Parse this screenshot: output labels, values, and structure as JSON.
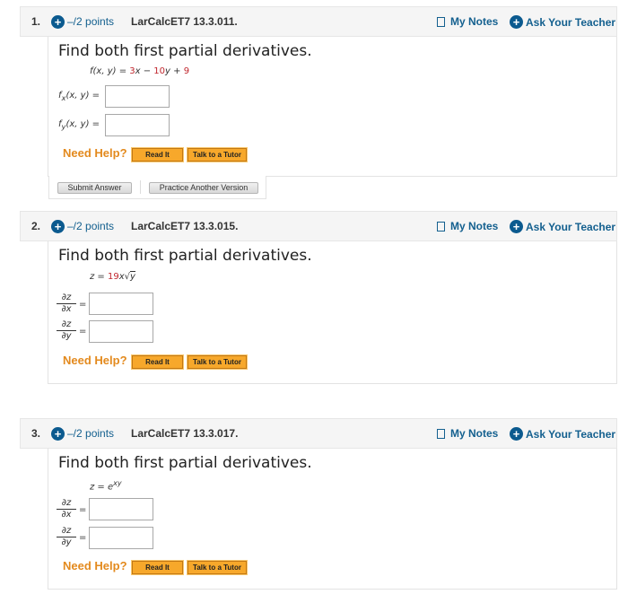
{
  "questions": [
    {
      "number": "1.",
      "points": "–/2 points",
      "code": "LarCalcET7 13.3.011.",
      "my_notes": "My Notes",
      "ask_teacher": "Ask Your Teacher",
      "prompt": "Find both first partial derivatives.",
      "equation": {
        "lhs": "f(x, y) = ",
        "parts": [
          "3",
          "x − ",
          "10",
          "y + ",
          "9"
        ]
      },
      "answers": [
        {
          "label": "f",
          "sub": "x",
          "rest": "(x, y)  =",
          "value": ""
        },
        {
          "label": "f",
          "sub": "y",
          "rest": "(x, y)  =",
          "value": ""
        }
      ],
      "need_help": "Need Help?",
      "read_it": "Read It",
      "talk_tutor": "Talk to a Tutor",
      "submit": "Submit Answer",
      "practice": "Practice Another Version"
    },
    {
      "number": "2.",
      "points": "–/2 points",
      "code": "LarCalcET7 13.3.015.",
      "my_notes": "My Notes",
      "ask_teacher": "Ask Your Teacher",
      "prompt": "Find both first partial derivatives.",
      "equation": {
        "lhs": "z = ",
        "coef": "19",
        "rest": "x",
        "sqrt": "y"
      },
      "answers": [
        {
          "num": "∂z",
          "den": "∂x",
          "eq": "=",
          "value": ""
        },
        {
          "num": "∂z",
          "den": "∂y",
          "eq": "=",
          "value": ""
        }
      ],
      "need_help": "Need Help?",
      "read_it": "Read It",
      "talk_tutor": "Talk to a Tutor"
    },
    {
      "number": "3.",
      "points": "–/2 points",
      "code": "LarCalcET7 13.3.017.",
      "my_notes": "My Notes",
      "ask_teacher": "Ask Your Teacher",
      "prompt": "Find both first partial derivatives.",
      "equation": {
        "lhs": "z = e",
        "sup": "xy"
      },
      "answers": [
        {
          "num": "∂z",
          "den": "∂x",
          "eq": "=",
          "value": ""
        },
        {
          "num": "∂z",
          "den": "∂y",
          "eq": "=",
          "value": ""
        }
      ],
      "need_help": "Need Help?",
      "read_it": "Read It",
      "talk_tutor": "Talk to a Tutor"
    }
  ],
  "icons": {
    "plus": "+",
    "notes": "notes-icon"
  },
  "colors": {
    "accent_blue": "#0b5a8f",
    "link_blue": "#14608f",
    "help_orange": "#e38a1e",
    "button_orange": "#f7a82b",
    "math_red": "#c0262d"
  }
}
